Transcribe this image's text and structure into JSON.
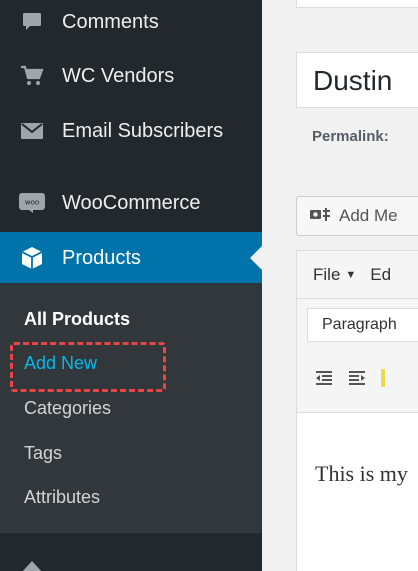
{
  "sidebar": {
    "items": [
      {
        "label": "Comments",
        "icon": "comment-bubble-icon"
      },
      {
        "label": "WC Vendors",
        "icon": "cart-icon"
      },
      {
        "label": "Email Subscribers",
        "icon": "envelope-icon"
      },
      {
        "label": "WooCommerce",
        "icon": "woocommerce-icon"
      },
      {
        "label": "Products",
        "icon": "box-icon",
        "current": true
      }
    ],
    "submenu": [
      {
        "label": "All Products",
        "active": true
      },
      {
        "label": "Add New",
        "highlighted": true
      },
      {
        "label": "Categories"
      },
      {
        "label": "Tags"
      },
      {
        "label": "Attributes"
      }
    ],
    "colors": {
      "background": "#23282d",
      "submenu_background": "#32373c",
      "current_background": "#0073aa",
      "hover_text": "#00b9eb",
      "highlight_dash": "#e84545"
    }
  },
  "editor": {
    "title_value": "Dustin",
    "permalink_label": "Permalink: ",
    "add_media_label": "Add Me",
    "menubar": {
      "file": "File",
      "edit": "Ed"
    },
    "format_select": "Paragraph",
    "content": "This is my"
  }
}
